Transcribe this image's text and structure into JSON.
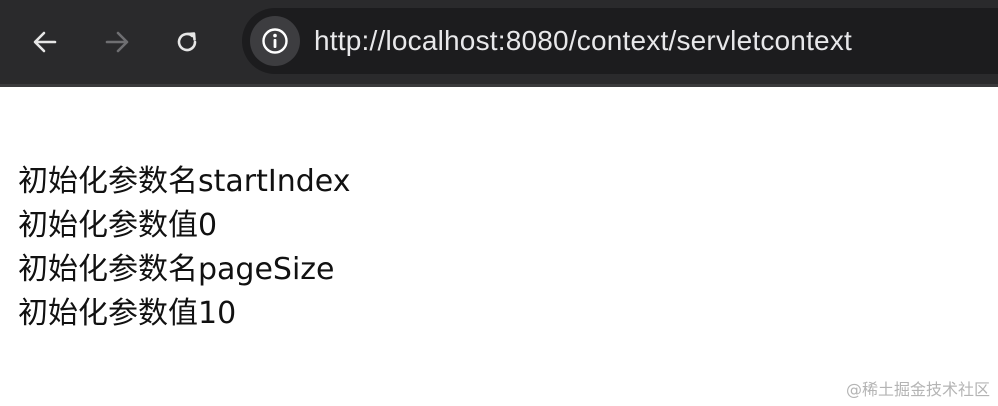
{
  "browser": {
    "url": "http://localhost:8080/context/servletcontext",
    "icons": {
      "back": "arrow-left-icon",
      "forward": "arrow-right-icon",
      "reload": "reload-icon",
      "site_info": "info-circle-icon"
    },
    "colors": {
      "toolbar": "#2a2a2c",
      "omnibox": "#1c1c1e",
      "url_text": "#e8e8ea"
    }
  },
  "page": {
    "lines": [
      "初始化参数名startIndex",
      "初始化参数值0",
      "初始化参数名pageSize",
      "初始化参数值10"
    ]
  },
  "watermark": "@稀土掘金技术社区"
}
